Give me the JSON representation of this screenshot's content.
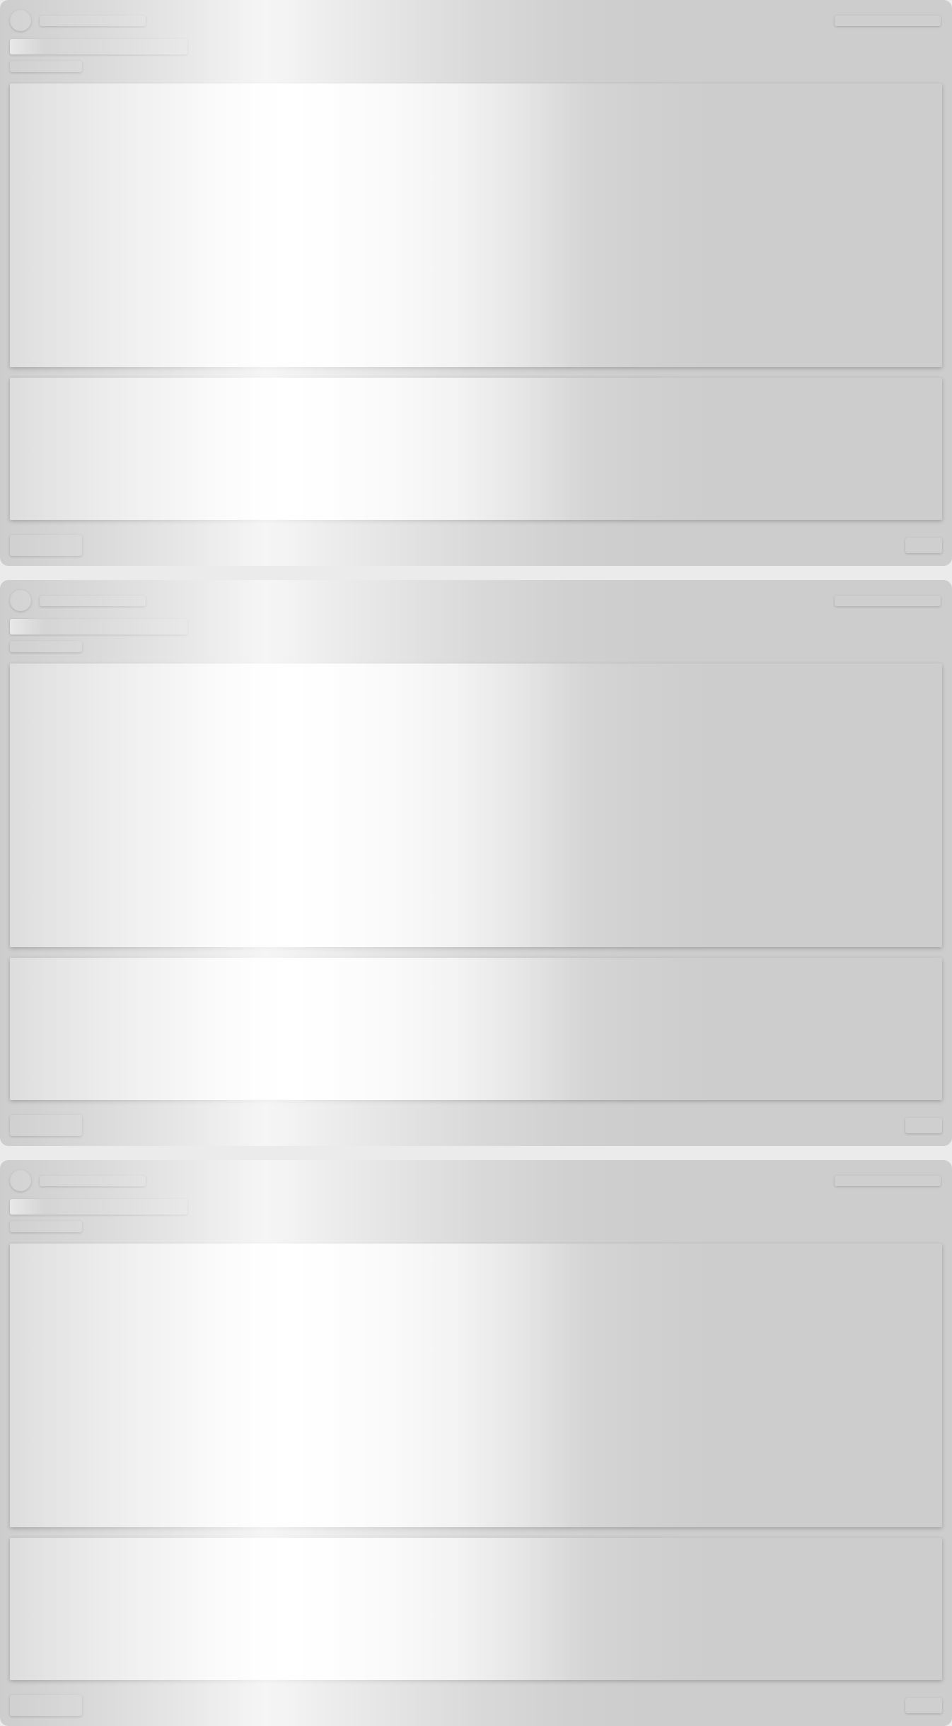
{
  "feed": {
    "state": "loading",
    "cards": [
      {
        "index": 1,
        "state": "loading"
      },
      {
        "index": 2,
        "state": "loading"
      },
      {
        "index": 3,
        "state": "loading"
      }
    ]
  },
  "colors": {
    "background": "#ebebeb",
    "card": "#cdcdcd",
    "placeholder": "#cfcfcf",
    "shimmer_highlight": "#ffffff"
  }
}
